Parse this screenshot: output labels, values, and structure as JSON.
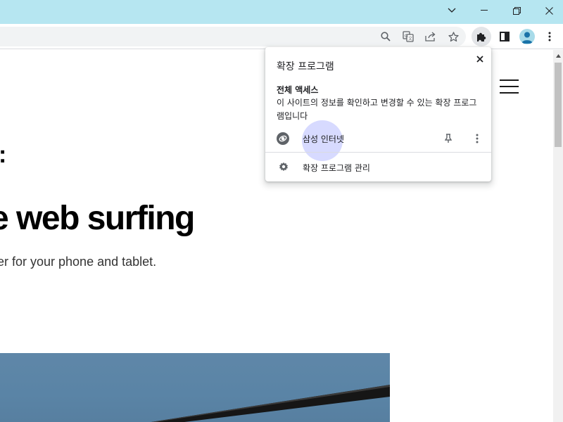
{
  "window": {
    "accent": "#b6e6f1",
    "controls": [
      "chevron-down-icon",
      "minimize-icon",
      "restore-icon",
      "close-icon"
    ]
  },
  "toolbar": {
    "icons": [
      "zoom-icon",
      "translate-icon",
      "share-icon",
      "bookmark-star-icon",
      "extensions-puzzle-icon",
      "side-panel-icon",
      "profile-avatar-icon",
      "kebab-menu-icon"
    ]
  },
  "page": {
    "headline": "e web surfing",
    "subline": "er for your phone and tablet.",
    "colon_mark": ":"
  },
  "extensions_popup": {
    "title": "확장 프로그램",
    "section_title": "전체 액세스",
    "section_desc": "이 사이트의 정보를 확인하고 변경할 수 있는 확장 프로그램입니다",
    "extension_name": "삼성 인터넷",
    "manage_label": "확장 프로그램 관리"
  }
}
